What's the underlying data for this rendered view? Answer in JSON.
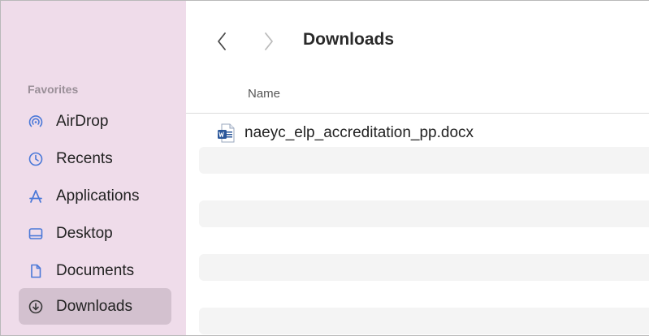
{
  "window": {
    "title": "Downloads"
  },
  "sidebar": {
    "section_label": "Favorites",
    "items": [
      {
        "label": "AirDrop",
        "icon": "airdrop-icon"
      },
      {
        "label": "Recents",
        "icon": "clock-icon"
      },
      {
        "label": "Applications",
        "icon": "applications-icon"
      },
      {
        "label": "Desktop",
        "icon": "desktop-icon"
      },
      {
        "label": "Documents",
        "icon": "document-icon"
      },
      {
        "label": "Downloads",
        "icon": "download-icon",
        "selected": true
      }
    ]
  },
  "list": {
    "column_name": "Name",
    "files": [
      {
        "name": "naeyc_elp_accreditation_pp.docx",
        "icon": "word-document-icon"
      }
    ]
  },
  "colors": {
    "sidebar_bg": "#efdcea",
    "selected_bg": "#d3c1cf",
    "accent_blue": "#4a78d8"
  }
}
